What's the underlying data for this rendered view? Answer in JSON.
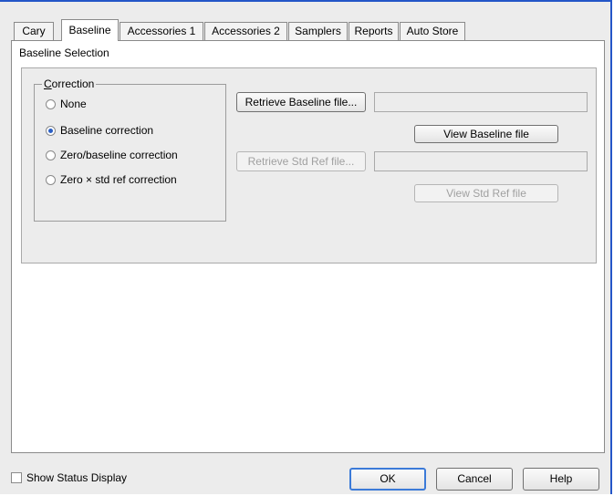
{
  "tabs": [
    {
      "label": "Cary"
    },
    {
      "label": "Baseline"
    },
    {
      "label": "Accessories 1"
    },
    {
      "label": "Accessories 2"
    },
    {
      "label": "Samplers"
    },
    {
      "label": "Reports"
    },
    {
      "label": "Auto Store"
    }
  ],
  "active_tab": "Baseline",
  "baseline": {
    "section_label": "Baseline Selection",
    "correction_group": {
      "title": "Correction",
      "options": [
        {
          "label": "None",
          "checked": false
        },
        {
          "label": "Baseline correction",
          "checked": true
        },
        {
          "label": "Zero/baseline correction",
          "checked": false
        },
        {
          "label": "Zero × std ref correction",
          "checked": false
        }
      ]
    },
    "retrieve_baseline_label": "Retrieve Baseline file...",
    "baseline_file_value": "",
    "view_baseline_label": "View Baseline file",
    "retrieve_std_ref_label": "Retrieve Std Ref file...",
    "std_ref_file_value": "",
    "view_std_ref_label": "View Std Ref file"
  },
  "footer": {
    "show_status_label": "Show Status Display",
    "show_status_checked": false,
    "ok_label": "OK",
    "cancel_label": "Cancel",
    "help_label": "Help"
  },
  "colors": {
    "accent": "#2456c8",
    "radio_dot": "#2a5fc4",
    "default_button_border": "#3b7ad8",
    "disabled_text": "#a0a0a0"
  }
}
